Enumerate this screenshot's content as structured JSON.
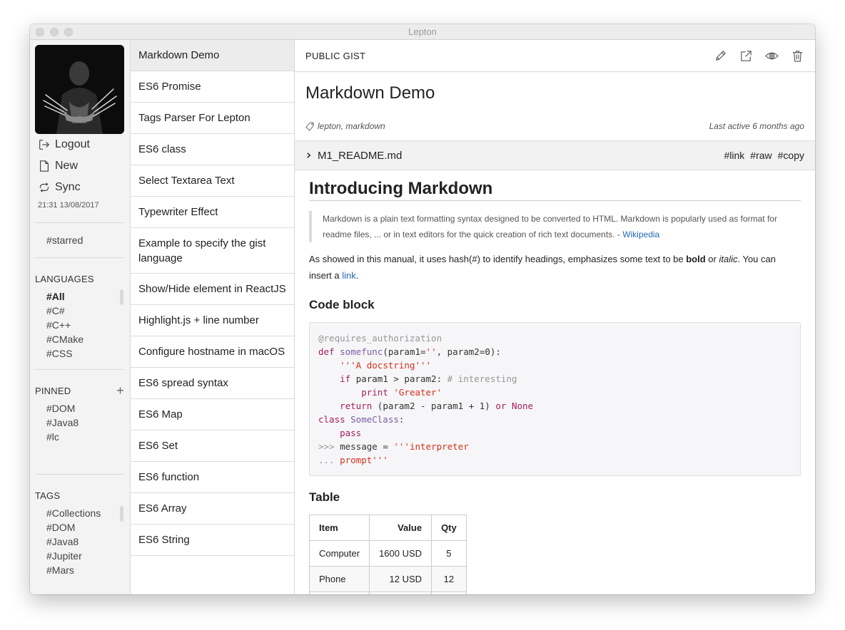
{
  "window": {
    "title": "Lepton"
  },
  "sidebar": {
    "actions": [
      {
        "label": "Logout",
        "icon": "logout-icon"
      },
      {
        "label": "New",
        "icon": "file-icon"
      },
      {
        "label": "Sync",
        "icon": "sync-icon"
      }
    ],
    "sync_time": "21:31 13/08/2017",
    "starred": "#starred",
    "languages": {
      "title": "LANGUAGES",
      "items": [
        "#All",
        "#C#",
        "#C++",
        "#CMake",
        "#CSS"
      ],
      "active": "#All"
    },
    "pinned": {
      "title": "PINNED",
      "add_label": "+",
      "items": [
        "#DOM",
        "#Java8",
        "#lc"
      ]
    },
    "tags": {
      "title": "TAGS",
      "items": [
        "#Collections",
        "#DOM",
        "#Java8",
        "#Jupiter",
        "#Mars"
      ]
    }
  },
  "gists": [
    "Markdown Demo",
    "ES6 Promise",
    "Tags Parser For Lepton",
    "ES6 class",
    "Select Textarea Text",
    "Typewriter Effect",
    "Example to specify the gist language",
    "Show/Hide element in ReactJS",
    "Highlight.js + line number",
    "Configure hostname in macOS",
    "ES6 spread syntax",
    "ES6 Map",
    "ES6 Set",
    "ES6 function",
    "ES6 Array",
    "ES6 String"
  ],
  "main": {
    "visibility_label": "PUBLIC GIST",
    "header_icons": [
      "pencil-icon",
      "external-link-icon",
      "eye-icon",
      "trash-icon"
    ],
    "title": "Markdown Demo",
    "tags": "lepton, markdown",
    "last_active": "Last active 6 months ago",
    "file": {
      "name": "M1_README.md",
      "links": [
        "#link",
        "#raw",
        "#copy"
      ]
    },
    "content": {
      "h1": "Introducing Markdown",
      "quote_text": "Markdown is a plain text formatting syntax designed to be converted to HTML. Markdown is popularly used as format for readme files, ... or in text editors for the quick creation of rich text documents. - ",
      "quote_link": "Wikipedia",
      "para_1": "As showed in this manual, it uses hash(#) to identify headings, emphasizes some text to be ",
      "para_bold": "bold",
      "para_2": " or ",
      "para_italic": "italic",
      "para_3": ". You can insert a ",
      "para_link": "link",
      "para_4": ".",
      "code_heading": "Code block",
      "code_lines": [
        [
          [
            "c-com",
            "@requires_authorization"
          ]
        ],
        [
          [
            "c-kw",
            "def "
          ],
          [
            "c-fn",
            "somefunc"
          ],
          [
            "",
            "(param1="
          ],
          [
            "c-str",
            "''"
          ],
          [
            "",
            ", param2=0):"
          ]
        ],
        [
          [
            "",
            "    "
          ],
          [
            "c-str",
            "'''A docstring'''"
          ]
        ],
        [
          [
            "",
            "    "
          ],
          [
            "c-kw",
            "if "
          ],
          [
            "",
            "param1 > param2: "
          ],
          [
            "c-com",
            "# interesting"
          ]
        ],
        [
          [
            "",
            "        "
          ],
          [
            "c-kw",
            "print "
          ],
          [
            "c-str",
            "'Greater'"
          ]
        ],
        [
          [
            "",
            "    "
          ],
          [
            "c-kw",
            "return "
          ],
          [
            "",
            "(param2 - param1 + 1) "
          ],
          [
            "c-kw",
            "or "
          ],
          [
            "c-none",
            "None"
          ]
        ],
        [
          [
            "c-kw",
            "class "
          ],
          [
            "c-fn",
            "SomeClass"
          ],
          [
            "",
            ":"
          ]
        ],
        [
          [
            "",
            "    "
          ],
          [
            "c-kw",
            "pass"
          ]
        ],
        [
          [
            "c-com",
            ">>> "
          ],
          [
            "",
            "message = "
          ],
          [
            "c-str",
            "'''interpreter"
          ]
        ],
        [
          [
            "c-com",
            "... "
          ],
          [
            "c-str",
            "prompt'''"
          ]
        ]
      ],
      "table_heading": "Table",
      "table": {
        "headers": [
          "Item",
          "Value",
          "Qty"
        ],
        "rows": [
          [
            "Computer",
            "1600 USD",
            "5"
          ],
          [
            "Phone",
            "12 USD",
            "12"
          ],
          [
            "",
            "",
            ""
          ]
        ]
      }
    }
  },
  "colors": {
    "link": "#2767b1",
    "code_keyword": "#a71d5d",
    "code_string": "#d62f1c",
    "code_function": "#795da3",
    "code_comment": "#969896"
  }
}
